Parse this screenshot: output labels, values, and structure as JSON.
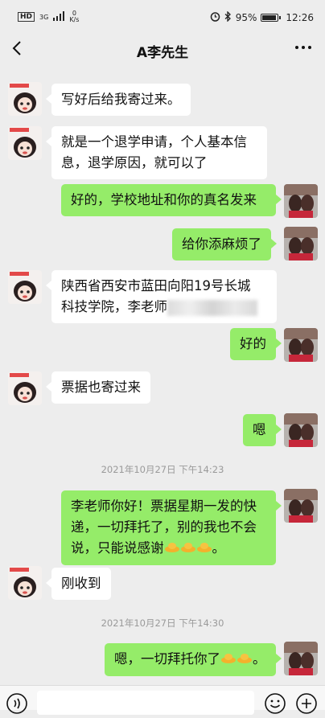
{
  "status_bar": {
    "hd": "HD",
    "network_type": "3G",
    "speed_value": "0",
    "speed_unit": "K/s",
    "battery_text": "95%",
    "battery_level": 0.95,
    "time": "12:26",
    "icons": [
      "alarm-icon",
      "bluetooth-icon",
      "battery-icon",
      "signal-icon"
    ]
  },
  "header": {
    "title": "A李先生",
    "back_icon": "back-arrow-icon",
    "more_icon": "more-dots-icon"
  },
  "messages": [
    {
      "side": "in",
      "text": "写好后给我寄过来。"
    },
    {
      "side": "in",
      "line1": "就是一个退学申请，个人基本信",
      "line2": "息，退学原因，就可以了"
    },
    {
      "side": "out",
      "text": "好的，学校地址和你的真名发来"
    },
    {
      "side": "out",
      "text": "给你添麻烦了"
    },
    {
      "side": "in",
      "line1": "陕西省西安市蓝田向阳19号长城",
      "line2": "科技学院，李老师"
    },
    {
      "side": "out",
      "text": "好的"
    },
    {
      "side": "in",
      "text": "票据也寄过来"
    },
    {
      "side": "out",
      "text": "嗯"
    },
    {
      "side": "out",
      "line1": "李老师你好！票据星期一发的快",
      "line2": "递，一切拜托了，别的我也不会",
      "line3": "说，只能说感谢"
    },
    {
      "side": "in",
      "text": "刚收到"
    },
    {
      "side": "out",
      "text": "嗯，一切拜托你了"
    }
  ],
  "timestamps": [
    "2021年10月27日 下午14:23",
    "2021年10月27日 下午14:30"
  ],
  "message_end_mark": "。",
  "colors": {
    "background": "#ededed",
    "bubble_out": "#95ec69",
    "bubble_in": "#ffffff"
  }
}
